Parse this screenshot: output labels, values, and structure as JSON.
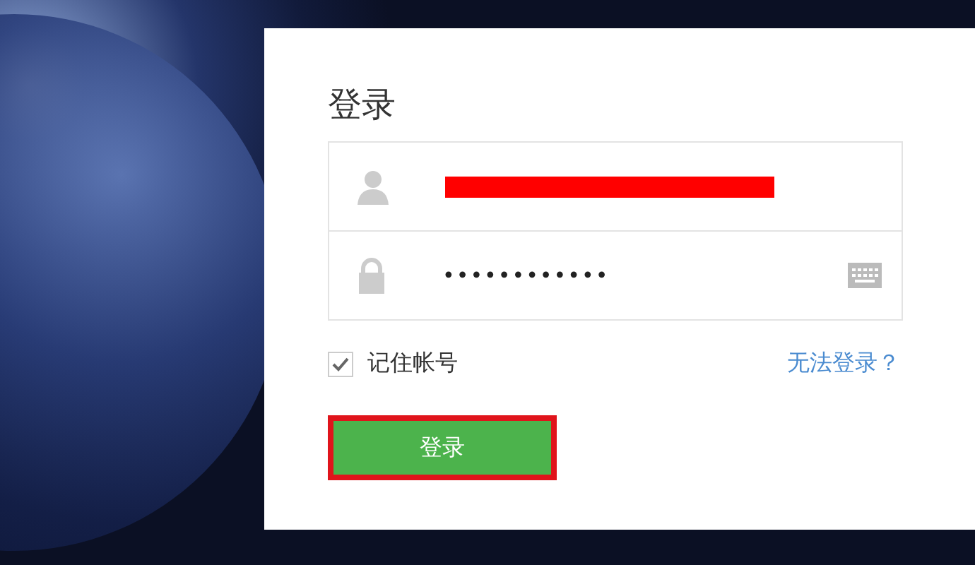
{
  "login_form": {
    "title": "登录",
    "password": {
      "value": "••••••••••••"
    },
    "remember": {
      "label": "记住帐号",
      "checked": true
    },
    "help_link": "无法登录？",
    "submit_button": {
      "label": "登录",
      "highlighted": true
    }
  }
}
